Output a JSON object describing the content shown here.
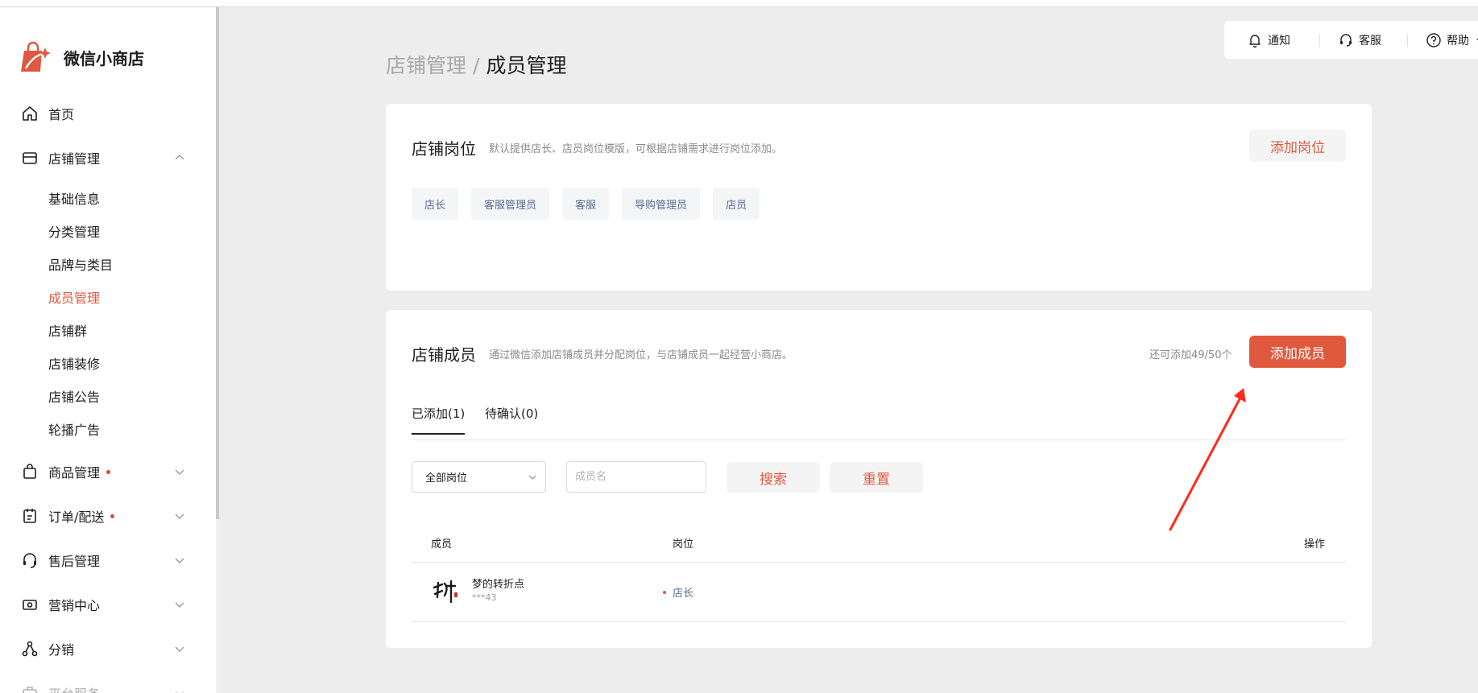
{
  "app": {
    "name": "微信小商店"
  },
  "sidebar": {
    "home": "首页",
    "store": {
      "label": "店铺管理",
      "children": [
        "基础信息",
        "分类管理",
        "品牌与类目",
        "成员管理",
        "店铺群",
        "店铺装修",
        "店铺公告",
        "轮播广告"
      ],
      "active": "成员管理"
    },
    "goods": "商品管理",
    "orders": "订单/配送",
    "aftersale": "售后管理",
    "marketing": "营销中心",
    "distribution": "分销",
    "platform": "平台服务"
  },
  "breadcrumb": {
    "parent": "店铺管理",
    "separator": "/",
    "current": "成员管理"
  },
  "topbar": {
    "notify": "通知",
    "service": "客服",
    "help": "帮助"
  },
  "roles_card": {
    "title": "店铺岗位",
    "desc": "默认提供店长、店员岗位模版，可根据店铺需求进行岗位添加。",
    "add_button": "添加岗位",
    "tags": [
      "店长",
      "客服管理员",
      "客服",
      "导购管理员",
      "店员"
    ]
  },
  "members_card": {
    "title": "店铺成员",
    "desc": "通过微信添加店铺成员并分配岗位，与店铺成员一起经营小商店。",
    "quota": "还可添加49/50个",
    "add_button": "添加成员",
    "tabs": [
      "已添加(1)",
      "待确认(0)"
    ],
    "filter": {
      "select_value": "全部岗位",
      "name_placeholder": "成员名",
      "search": "搜索",
      "reset": "重置"
    },
    "columns": {
      "member": "成员",
      "role": "岗位",
      "actions": "操作"
    },
    "rows": [
      {
        "name": "梦的转折点",
        "id": "***43",
        "role": "店长"
      }
    ]
  },
  "colors": {
    "accent": "#e0593f",
    "tag_text": "#576b95",
    "background": "#ededed"
  }
}
